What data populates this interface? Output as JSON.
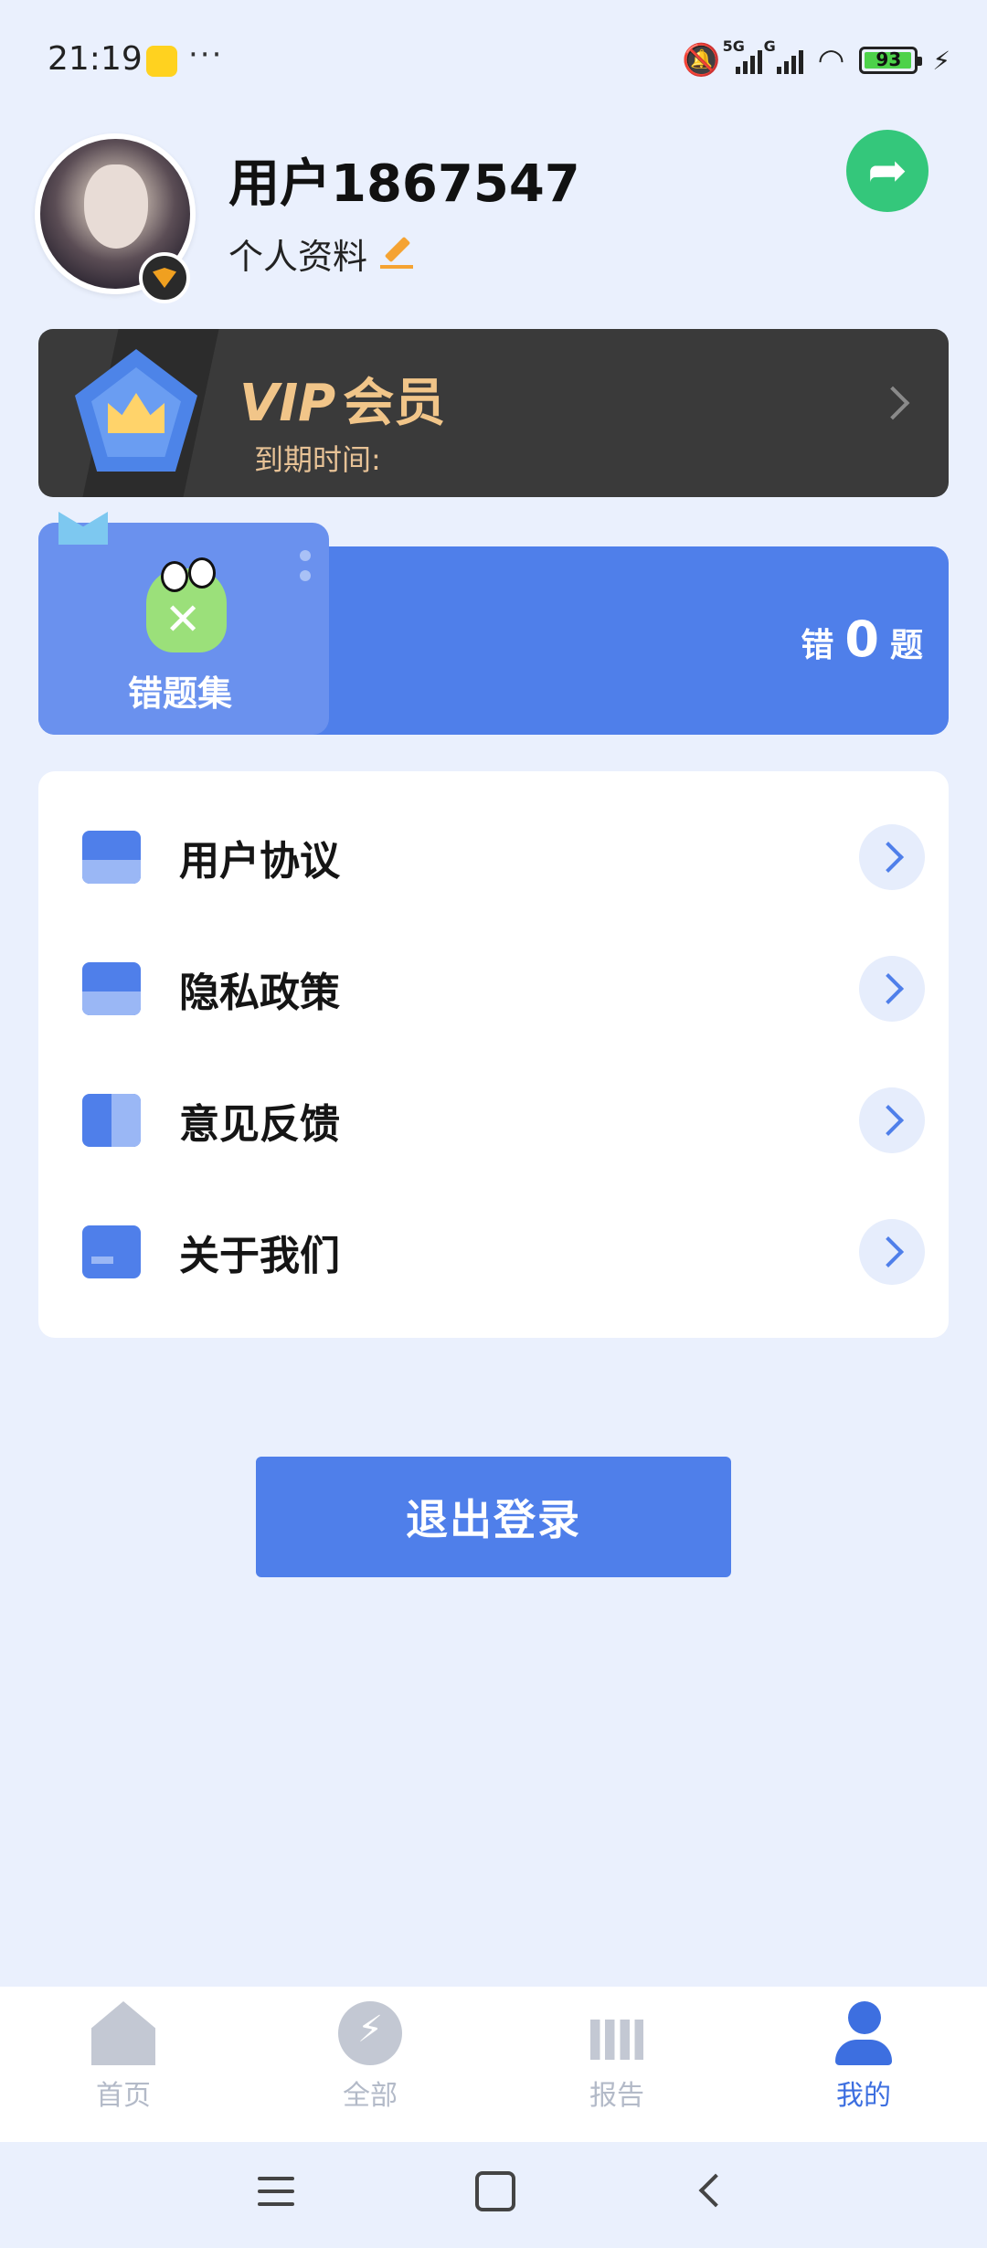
{
  "status_bar": {
    "time": "21:19",
    "more": "···",
    "network_5g": "5G",
    "network_g": "G",
    "battery": "93"
  },
  "profile": {
    "username": "用户1867547",
    "profile_link": "个人资料"
  },
  "vip": {
    "title": "VIP",
    "member": "会员",
    "expire_label": "到期时间:"
  },
  "wrong_questions": {
    "label": "错题集",
    "prefix": "错",
    "count": "0",
    "suffix": "题"
  },
  "menu": {
    "items": [
      {
        "label": "用户协议"
      },
      {
        "label": "隐私政策"
      },
      {
        "label": "意见反馈"
      },
      {
        "label": "关于我们"
      }
    ]
  },
  "logout": {
    "label": "退出登录"
  },
  "bottom_nav": {
    "items": [
      {
        "label": "首页"
      },
      {
        "label": "全部"
      },
      {
        "label": "报告"
      },
      {
        "label": "我的"
      }
    ]
  },
  "colors": {
    "accent": "#4f7fea",
    "background": "#eaf0fd",
    "vip_card": "#3a3a3a",
    "vip_text": "#f1c589",
    "share_button": "#34c77b",
    "nav_active": "#3d6fe0",
    "nav_inactive": "#b3bac8"
  }
}
